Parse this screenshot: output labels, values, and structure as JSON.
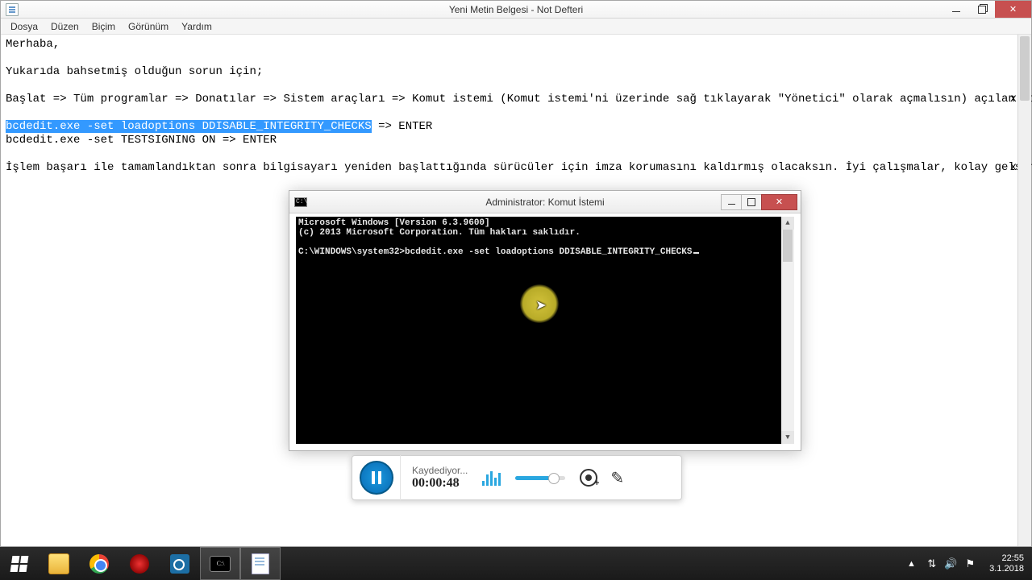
{
  "notepad": {
    "title": "Yeni Metin Belgesi - Not Defteri",
    "menu": [
      "Dosya",
      "Düzen",
      "Biçim",
      "Görünüm",
      "Yardım"
    ],
    "lines": {
      "l1": "Merhaba,",
      "l2": "",
      "l3": "Yukarıda bahsetmiş olduğun sorun için;",
      "l4": "",
      "l5": "Başlat => Tüm programlar => Donatılar => Sistem araçları => Komut istemi (Komut istemi'ni üzerinde sağ tıklayarak \"Yönetici\" olarak açmalısın) açılan dos ekranına.",
      "l6": "",
      "l7_sel": "bcdedit.exe -set loadoptions DDISABLE_INTEGRITY_CHECKS",
      "l7_rest": " => ENTER",
      "l8": "bcdedit.exe -set TESTSIGNING ON => ENTER",
      "l9": "",
      "l10": "İşlem başarı ile tamamlandıktan sonra bilgisayarı yeniden başlattığında sürücüler için imza korumasını kaldırmış olacaksın. İyi çalışmalar, kolay gelsin."
    },
    "truncx": {
      "t1": "x",
      "t2": "x"
    }
  },
  "cmd": {
    "title": "Administrator: Komut İstemi",
    "line1": "Microsoft Windows [Version 6.3.9600]",
    "line2": "(c) 2013 Microsoft Corporation. Tüm hakları saklıdır.",
    "prompt": "C:\\WINDOWS\\system32>",
    "typed": "bcdedit.exe -set loadoptions DDISABLE_INTEGRITY_CHECKS"
  },
  "recorder": {
    "status": "Kaydediyor...",
    "time": "00:00:48"
  },
  "taskbar": {
    "time": "22:55",
    "date": "3.1.2018"
  }
}
